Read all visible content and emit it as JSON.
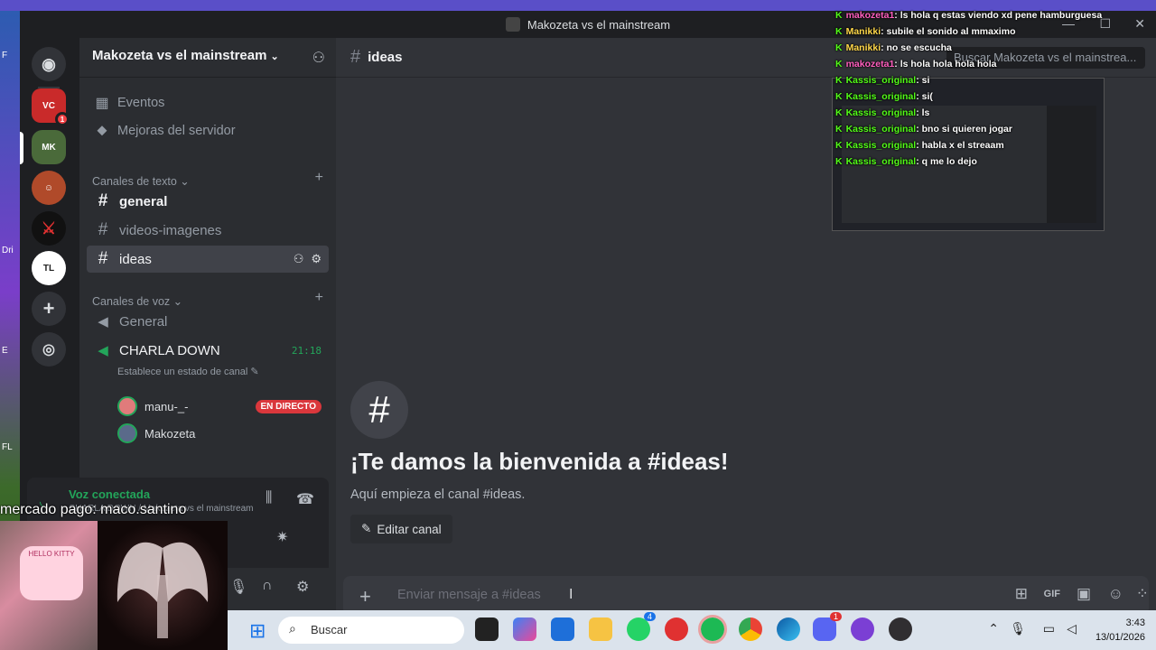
{
  "desktop": {
    "labels": [
      "F",
      "Dri",
      "E",
      "FL"
    ]
  },
  "window": {
    "title": "Makozeta vs el mainstream",
    "controls": [
      "—",
      "☐",
      "✕"
    ]
  },
  "server": {
    "name": "Makozeta vs el mainstream",
    "menu": [
      {
        "label": "Eventos",
        "icon": "calendar-icon"
      },
      {
        "label": "Mejoras del servidor",
        "icon": "boost-icon"
      }
    ],
    "text_category": "Canales de texto",
    "text_channels": [
      {
        "name": "general",
        "state": "unread"
      },
      {
        "name": "videos-imagenes",
        "state": "normal"
      },
      {
        "name": "ideas",
        "state": "active"
      }
    ],
    "voice_category": "Canales de voz",
    "voice_channels": [
      {
        "name": "General"
      },
      {
        "name": "CHARLA DOWN",
        "timer": "21:18",
        "status": "Establece un estado de canal"
      }
    ],
    "voice_users": [
      {
        "name": "manu-_-",
        "badge": "EN DIRECTO"
      },
      {
        "name": "Makozeta"
      }
    ]
  },
  "voice_panel": {
    "status": "Voz conectada",
    "sub": "CHARLA DOWN / Makozeta vs el mainstream"
  },
  "overlay": {
    "payment": "mercado pago: maco.santino"
  },
  "main": {
    "channel": "ideas",
    "search_placeholder": "Buscar Makozeta vs el mainstrea...",
    "welcome_title": "¡Te damos la bienvenida a #ideas!",
    "welcome_sub": "Aquí empieza el canal #ideas.",
    "edit_label": "Editar canal",
    "composer_placeholder": "Enviar mensaje a #ideas"
  },
  "stream_chat": [
    {
      "user": "makozeta1",
      "color": "pink",
      "text": ": ls hola q estas viendo xd pene hamburguesa"
    },
    {
      "user": "Manikki",
      "color": "yel",
      "text": ": subile el sonido al mmaximo"
    },
    {
      "user": "Manikki",
      "color": "yel",
      "text": ": no se escucha"
    },
    {
      "user": "makozeta1",
      "color": "pink",
      "text": ": ls hola hola hola hola"
    },
    {
      "user": "Kassis_original",
      "color": "grn",
      "text": ": si"
    },
    {
      "user": "Kassis_original",
      "color": "grn",
      "text": ": si("
    },
    {
      "user": "Kassis_original",
      "color": "grn",
      "text": ": ls"
    },
    {
      "user": "Kassis_original",
      "color": "grn",
      "text": ": bno si quieren jogar"
    },
    {
      "user": "Kassis_original",
      "color": "grn",
      "text": ": habla x el streaam"
    },
    {
      "user": "Kassis_original",
      "color": "grn",
      "text": ": q me lo dejo"
    }
  ],
  "webcam": {
    "sticker": "HELLO KITTY"
  },
  "taskbar": {
    "search": "Buscar",
    "time": "3:43",
    "date": "13/01/2026",
    "whatsapp_badge": "4",
    "discord_badge": "1"
  },
  "colors": {
    "accent": "#5865f2",
    "live": "#da373c",
    "voice": "#23a55a",
    "kick": "#53fc18"
  }
}
